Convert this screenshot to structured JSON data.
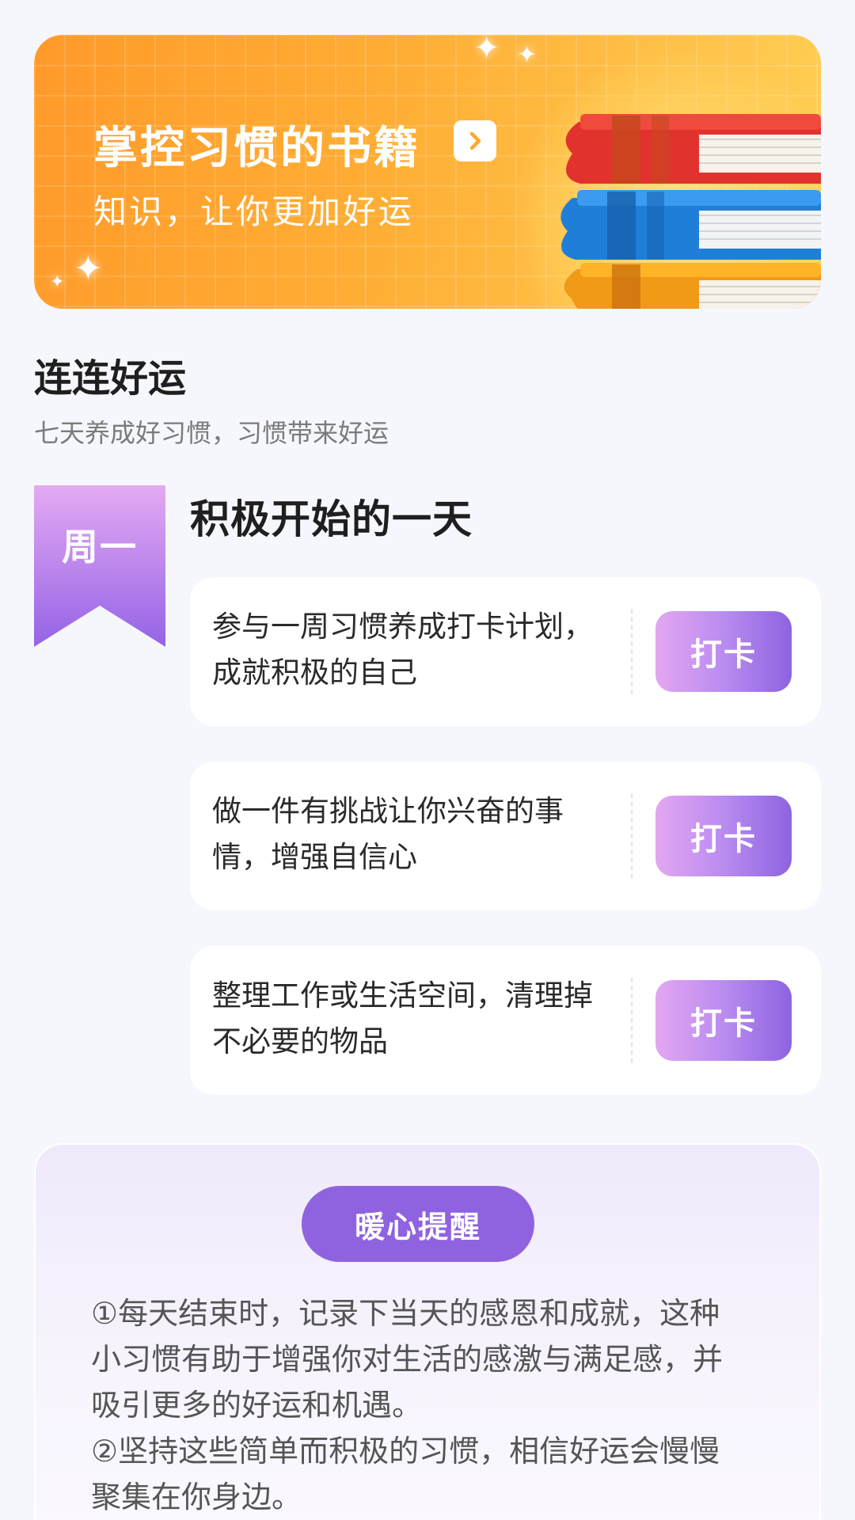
{
  "banner": {
    "title": "掌控习惯的书籍",
    "subtitle": "知识，让你更加好运",
    "arrow_icon": "chevron-right-icon",
    "illustration_icon": "stacked-books-icon"
  },
  "section": {
    "title": "连连好运",
    "subtitle": "七天养成好习惯，习惯带来好运"
  },
  "day": {
    "label": "周一",
    "title": "积极开始的一天"
  },
  "tasks": [
    {
      "text": "参与一周习惯养成打卡计划，成就积极的自己",
      "button": "打卡"
    },
    {
      "text": "做一件有挑战让你兴奋的事情，增强自信心",
      "button": "打卡"
    },
    {
      "text": "整理工作或生活空间，清理掉不必要的物品",
      "button": "打卡"
    }
  ],
  "tips": {
    "badge": "暖心提醒",
    "items": [
      "①每天结束时，记录下当天的感恩和成就，这种小习惯有助于增强你对生活的感激与满足感，并吸引更多的好运和机遇。",
      "②坚持这些简单而积极的习惯，相信好运会慢慢聚集在你身边。"
    ]
  },
  "colors": {
    "background": "#f6f7fc",
    "banner_orange": "#ffae35",
    "accent_purple": "#8f63df",
    "button_gradient_start": "#e4a6f1",
    "button_gradient_end": "#8e63e0"
  }
}
